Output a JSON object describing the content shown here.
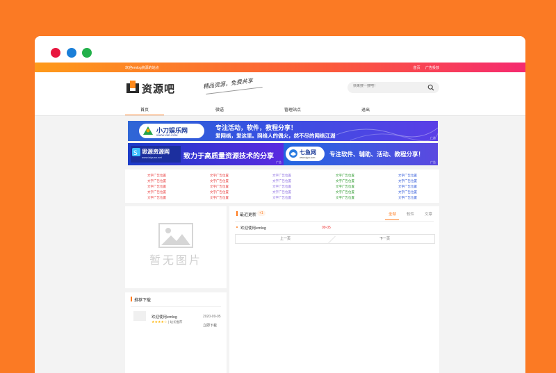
{
  "site": {
    "topbar": {
      "welcome": "欢迎emlog資源的站点",
      "links": [
        "首页",
        "广告投放"
      ]
    },
    "logo_text": "资源吧",
    "slogan": "精品资源，免费共享",
    "search_placeholder": "快来搜一搜吧！",
    "nav": [
      "首页",
      "微语",
      "管理站点",
      "退出"
    ]
  },
  "banners": {
    "banner1": {
      "logo": "小刀娱乐网",
      "url": "WWW.X6D.COM",
      "line1": "专注活动，软件，教程分享！",
      "line2": "爱网络，爱这里。网络人的偶火，然不尽的网络江湖",
      "tag": "广告"
    },
    "banner2_left": {
      "logo": "思源资源网",
      "url": "www.isiyuan.net",
      "text": "致力于高质量资源技术的分享",
      "tag": "广告"
    },
    "banner2_right": {
      "logo": "七鱼网",
      "url": "www.qiyu.com",
      "text": "专注软件、辅助、活动、教程分享！",
      "tag": "广告"
    }
  },
  "text_ads": {
    "label": "文字广告位置",
    "columns": 5,
    "rows": 5,
    "colors": [
      "#e83a3a",
      "#e83a3a",
      "#8a6be0",
      "#2c9a2c",
      "#2b55d8"
    ]
  },
  "left": {
    "no_image": "暂无图片",
    "recommend_title": "推荐下载",
    "item": {
      "name": "欢迎使用emlog",
      "stars": "★★★★☆",
      "tag": "| 站长推荐",
      "date": "2020-09-05",
      "download": "立即下载"
    }
  },
  "main": {
    "title": "最近更新",
    "badge": "+1",
    "tabs": [
      "全部",
      "软件",
      "文章"
    ],
    "post": {
      "title": "欢迎使用emlog",
      "date": "09-05"
    },
    "prev": "上一页",
    "next": "下一页"
  },
  "colors": {
    "background": "#fb7a24",
    "accent": "#ff7a1c",
    "topbar_start": "#fe9a1a",
    "topbar_end": "#f52a6f"
  }
}
